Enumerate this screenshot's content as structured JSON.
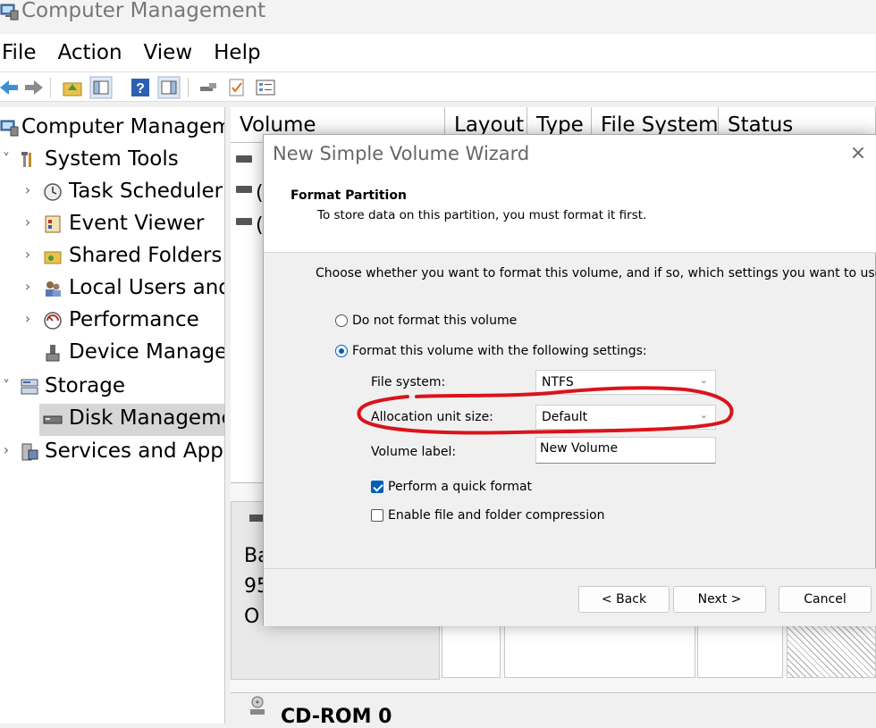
{
  "window": {
    "title": "Computer Management"
  },
  "menu": [
    "File",
    "Action",
    "View",
    "Help"
  ],
  "tree": [
    {
      "label": "Computer Manageme",
      "icon": "computer-management-icon",
      "expander": ""
    },
    {
      "label": "System Tools",
      "icon": "system-tools-icon",
      "expander": "˅"
    },
    {
      "label": "Task Scheduler",
      "icon": "clock-icon",
      "expander": "›"
    },
    {
      "label": "Event Viewer",
      "icon": "event-viewer-icon",
      "expander": "›"
    },
    {
      "label": "Shared Folders",
      "icon": "shared-folders-icon",
      "expander": "›"
    },
    {
      "label": "Local Users and",
      "icon": "users-icon",
      "expander": "›"
    },
    {
      "label": "Performance",
      "icon": "performance-icon",
      "expander": "›"
    },
    {
      "label": "Device Manager",
      "icon": "device-manager-icon",
      "expander": ""
    },
    {
      "label": "Storage",
      "icon": "storage-icon",
      "expander": "˅"
    },
    {
      "label": "Disk Manageme",
      "icon": "disk-icon",
      "expander": "",
      "selected": true
    },
    {
      "label": "Services and Applic",
      "icon": "services-icon",
      "expander": "›"
    }
  ],
  "columns": [
    "Volume",
    "Layout",
    "Type",
    "File System",
    "Status"
  ],
  "volumes": [
    "(",
    "("
  ],
  "disk_panel": {
    "lines": [
      "Ba",
      "95",
      "O"
    ],
    "cdrom": "CD-ROM 0"
  },
  "wizard": {
    "title": "New Simple Volume Wizard",
    "close": "×",
    "header_title": "Format Partition",
    "header_subtitle": "To store data on this partition, you must format it first.",
    "instruction": "Choose whether you want to format this volume, and if so, which settings you want to use.",
    "radio_no_format": "Do not format this volume",
    "radio_format": "Format this volume with the following settings:",
    "selected_radio": "format",
    "file_system_label": "File system:",
    "file_system_value": "NTFS",
    "allocation_label": "Allocation unit size:",
    "allocation_value": "Default",
    "volume_label_label": "Volume label:",
    "volume_label_value": "New Volume",
    "quick_format": "Perform a quick format",
    "quick_format_checked": true,
    "compression": "Enable file and folder compression",
    "compression_checked": false,
    "back": "< Back",
    "next": "Next >",
    "cancel": "Cancel",
    "annotation_color": "#d9141a"
  }
}
